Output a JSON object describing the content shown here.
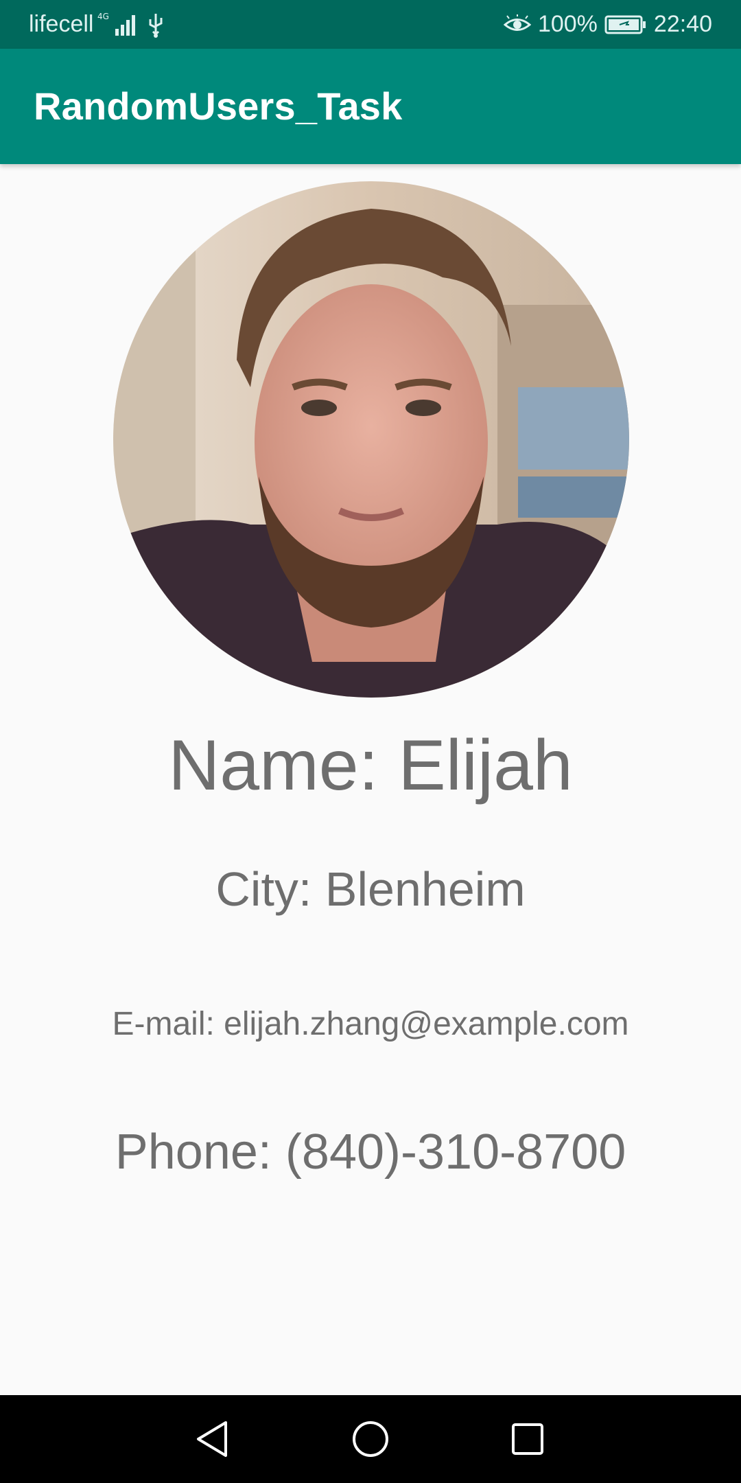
{
  "status_bar": {
    "carrier": "lifecell",
    "network_type": "4G",
    "battery": "100%",
    "time": "22:40",
    "icons": [
      "signal-icon",
      "usb-icon",
      "eye-icon",
      "battery-icon"
    ]
  },
  "app_bar": {
    "title": "RandomUsers_Task"
  },
  "profile": {
    "name": "Name: Elijah",
    "city": "City: Blenheim",
    "email": "E-mail: elijah.zhang@example.com",
    "phone": "Phone: (840)-310-8700"
  },
  "nav_bar": {
    "icons": [
      "back-icon",
      "home-icon",
      "recents-icon"
    ]
  },
  "colors": {
    "status_bar": "#00695c",
    "app_bar": "#00897b",
    "background": "#fafafa",
    "text": "#6e6e6e",
    "nav_bar": "#000000"
  }
}
